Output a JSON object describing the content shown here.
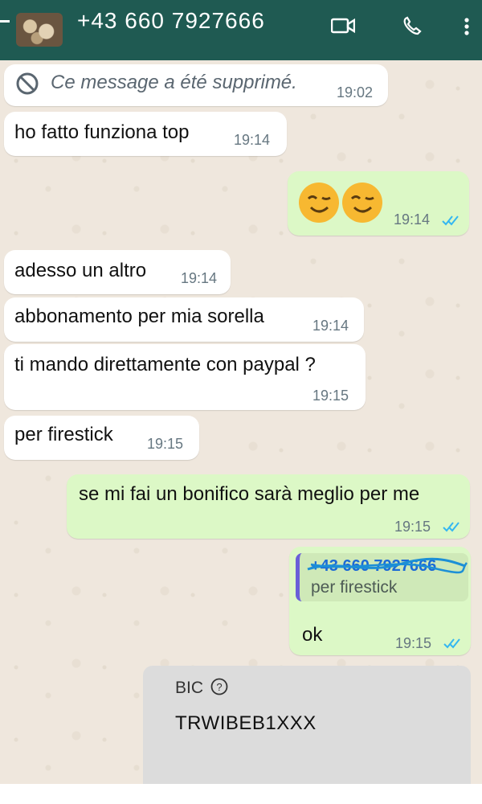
{
  "header": {
    "contact": "+43 660 7927666",
    "icons": [
      "back-arrow-icon",
      "video-call-icon",
      "phone-icon",
      "more-options-icon"
    ]
  },
  "messages": [
    {
      "id": "m1",
      "direction": "incoming",
      "type": "deleted",
      "text": "Ce message a été supprimé.",
      "time": "19:02",
      "icon": "deleted-icon"
    },
    {
      "id": "m2",
      "direction": "incoming",
      "text": "ho fatto funziona top",
      "time": "19:14"
    },
    {
      "id": "m3",
      "direction": "outgoing",
      "text": "😉😉",
      "time": "19:14",
      "status": "read"
    },
    {
      "id": "m4",
      "direction": "incoming",
      "text": "adesso un altro",
      "time": "19:14"
    },
    {
      "id": "m5",
      "direction": "incoming",
      "text": "abbonamento per mia sorella",
      "time": "19:14"
    },
    {
      "id": "m6",
      "direction": "incoming",
      "text": "ti mando direttamente con paypal ?",
      "time": "19:15"
    },
    {
      "id": "m7",
      "direction": "incoming",
      "text": "per firestick",
      "time": "19:15"
    },
    {
      "id": "m8",
      "direction": "outgoing",
      "text": "se mi fai un bonifico sarà meglio per me",
      "time": "19:15",
      "status": "read"
    },
    {
      "id": "m9",
      "direction": "outgoing",
      "quote": {
        "author": "+43 660 7927666",
        "text": "per firestick"
      },
      "text": "ok",
      "time": "19:15",
      "status": "read"
    }
  ],
  "bank_card": {
    "label": "BIC",
    "value": "TRWIBEB1XXX",
    "icon": "help-icon"
  },
  "colors": {
    "header": "#1f5a52",
    "incoming": "#ffffff",
    "outgoing": "#dcf8c6",
    "ticks": "#34b7f1"
  }
}
